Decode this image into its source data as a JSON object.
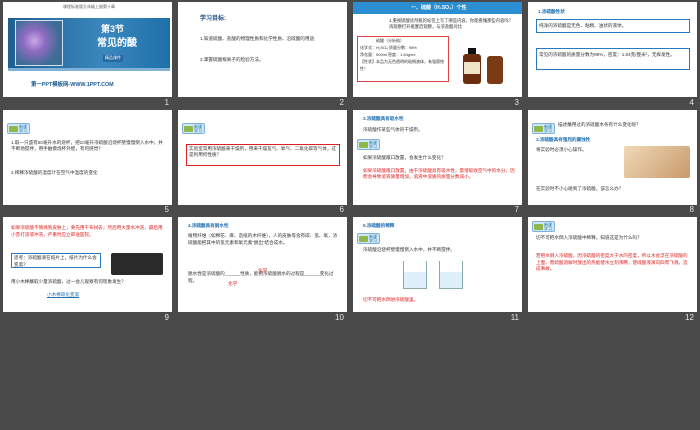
{
  "header_text": "课程标准版九年级上册第十章",
  "slides": [
    {
      "num": "1",
      "title_line1": "第3节",
      "title_line2": "常见的酸",
      "tag": "精品课件",
      "footer": "第一PPT模板网-WWW.1PPT.COM"
    },
    {
      "num": "2",
      "heading": "学习目标:",
      "p1": "1.知道硫酸、盐酸的物理性质和化学性质、沿硫酸的用途;",
      "p2": "2.掌握硫酸根离子的检验方法。"
    },
    {
      "num": "3",
      "banner": "一、硫酸（H₂SO₄）个性",
      "q": "1.重视硫酸试剂瓶的标签上写了哪些内容，你能看懂那些内容吗？再观察打开瓶塞后观察，与浓盐酸对比",
      "box_label": "硫酸（分析纯）",
      "box_lines": [
        "化学式：H₂SO₄    质量分数：98%",
        "净含量：500ml    密度：1.84g/ml",
        "【性状】本品为无色透明的粘稠液体，有强腐蚀性！"
      ]
    },
    {
      "num": "4",
      "s1_title": "1.浓硫酸性状",
      "s1_body": "纯净的浓硫酸是无色、粘稠、油状的液体。",
      "s2_body": "常见的浓硫酸的质量分数为98%，密度：1.84克/厘米³，无挥发性。"
    },
    {
      "num": "5",
      "p1": "1.取一只盛有50毫升水的烧杯，把10毫升浓硫酸沿烧杯壁慢慢倒入水中，并不断地搅拌，用手触摸烧杯外壁，有何感觉？",
      "p2": "2.稀释浓硫酸的温度计在空气中温度的变化"
    },
    {
      "num": "6",
      "box_text": "实验室常用浓硫酸来干燥剂，用来干燥氢气、氧气、二氧化碳等气体，这是利用何性质？"
    },
    {
      "num": "7",
      "s_title": "2.浓硫酸具有吸水性",
      "p1": "浓硫酸作某些气体的干燥剂。",
      "p2": "如果浓硫酸敞口放置，会发生什么变化？",
      "red": "如果浓硫酸敞口放置，由于浓硫酸具有吸水性，量增吸收空气中的水分，因而会导致溶液质量增加，溶液中溶质的质量分数减小。"
    },
    {
      "num": "8",
      "q1": "描述蘸用过的浓硫酸木条有什么变化呢？",
      "s_title": "3.浓硫酸具有强烈的腐蚀性",
      "p1": "将实验时必须小心操作。",
      "q2": "在实验时不小心碰到了浓硫酸，该怎么办？"
    },
    {
      "num": "9",
      "red": "如果浓硫酸不慎溅到皮肤上，要先用干布拭去，然后用大量水冲洗，最后用小苏打溶液冲洗，严重时应立即送医院。",
      "box_text": "思考：浓硫酸滴在纸片上，纸片为什么会变黑？",
      "p3": "用小木棒蘸取少量浓硫酸，过一会儿观察有何现象发生？",
      "link": "小木棒碳化变黑"
    },
    {
      "num": "10",
      "s_title": "4.浓硫酸具有脱水性",
      "p1": "植物纤维（如棉花、麻、造纸的木纤维），人的皮肤等含有碳、氢、氧，浓硫酸能把其中的氢元素和氧元素“脱出”结合成水。",
      "p2": "脱水性是浓硫酸的______性质，能把浓硫酸脱水的过程是______变化过程。",
      "fill1": "化学",
      "fill2": "化学"
    },
    {
      "num": "11",
      "s_title": "5.浓硫酸的稀释",
      "p1": "浓硫酸沿烧杯壁慢慢倒入水中，并不断搅拌。",
      "red": "切不可把水倒进浓硫酸里。"
    },
    {
      "num": "12",
      "q": "切不可把水倒入浓硫酸中稀释，知道这是为什么吗？",
      "red": "若把水倒入浓硫酸，因浓硫酸的密度大于水的密度，所以水会浮在浓硫酸的上面，而硫酸溶解时放出的热能使水立刻沸腾，使硫酸液滴向四周飞溅，造成事故。"
    }
  ],
  "pill_label": "新课学习"
}
